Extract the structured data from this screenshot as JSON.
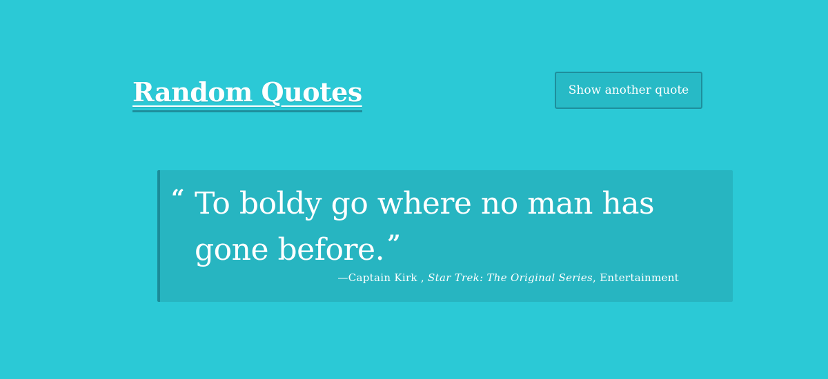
{
  "header": {
    "title": "Random Quotes",
    "next_button_label": "Show another quote"
  },
  "quote": {
    "open_mark": "“",
    "text": "To boldy go where no man has gone before.",
    "close_mark": "”",
    "dash": "—",
    "author": "Captain Kirk",
    "separator": " , ",
    "source": "Star Trek: The Original Series",
    "category_separator": ", ",
    "category": "Entertainment"
  },
  "colors": {
    "background": "#2bc9d6",
    "accent": "#1e8e9c",
    "quote_box": "#27b5c1"
  }
}
